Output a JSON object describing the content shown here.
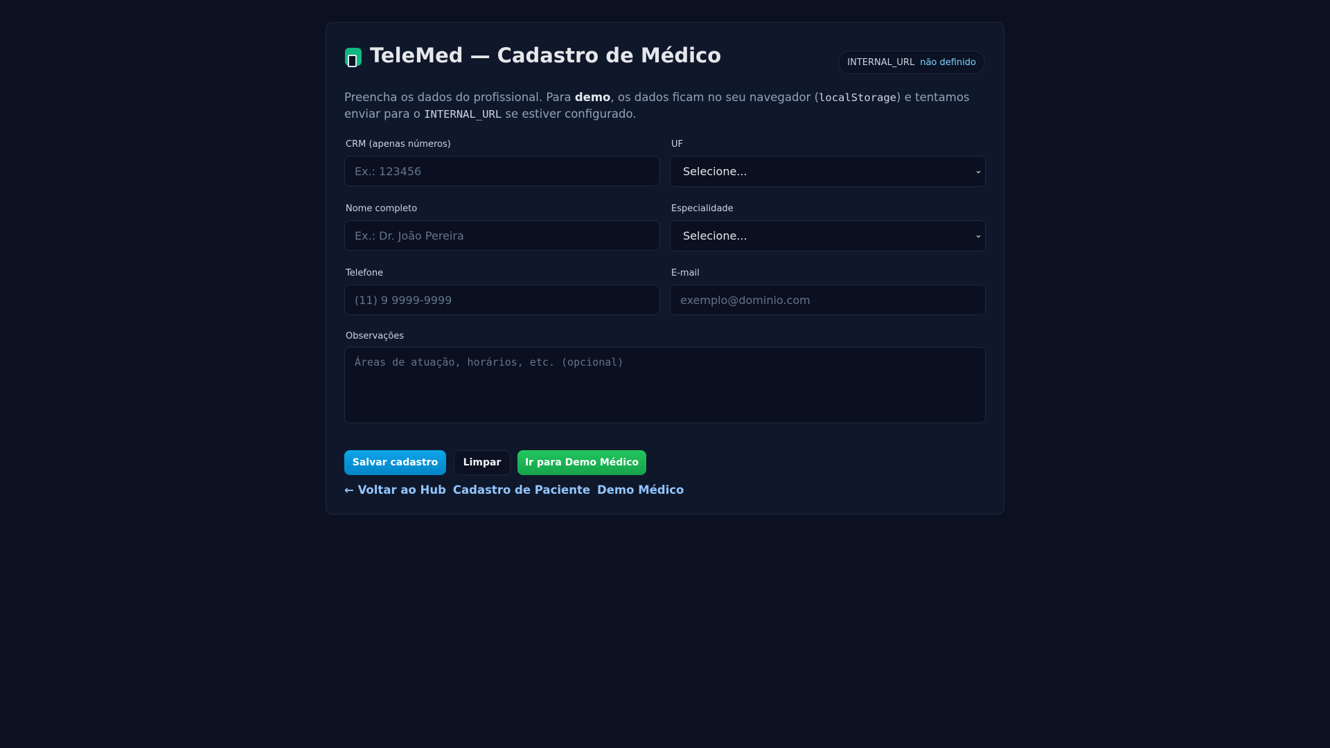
{
  "header": {
    "title": "TeleMed — Cadastro de Médico",
    "badge_key": "INTERNAL_URL",
    "badge_value": "não definido"
  },
  "description": {
    "part1": "Preencha os dados do profissional. Para ",
    "bold": "demo",
    "part2": ", os dados ficam no seu navegador (",
    "code1": "localStorage",
    "part3": ") e tentamos enviar para o ",
    "code2": "INTERNAL_URL",
    "part4": " se estiver configurado."
  },
  "form": {
    "crm": {
      "label": "CRM (apenas números)",
      "placeholder": "Ex.: 123456",
      "value": ""
    },
    "uf": {
      "label": "UF",
      "selected": "Selecione..."
    },
    "nome": {
      "label": "Nome completo",
      "placeholder": "Ex.: Dr. João Pereira",
      "value": ""
    },
    "especialidade": {
      "label": "Especialidade",
      "selected": "Selecione..."
    },
    "telefone": {
      "label": "Telefone",
      "placeholder": "(11) 9 9999-9999",
      "value": ""
    },
    "email": {
      "label": "E-mail",
      "placeholder": "exemplo@dominio.com",
      "value": ""
    },
    "observacoes": {
      "label": "Observações",
      "placeholder": "Áreas de atuação, horários, etc. (opcional)",
      "value": ""
    }
  },
  "actions": {
    "save": "Salvar cadastro",
    "clear": "Limpar",
    "demo": "Ir para Demo Médico"
  },
  "links": {
    "hub": "← Voltar ao Hub",
    "patient": "Cadastro de Paciente",
    "demo": "Demo Médico"
  },
  "colors": {
    "background": "#0b1120",
    "card": "#0f172a",
    "primary": "#0ea5e9",
    "success": "#22c55e",
    "link": "#93c5fd",
    "logo": "#10b981"
  }
}
